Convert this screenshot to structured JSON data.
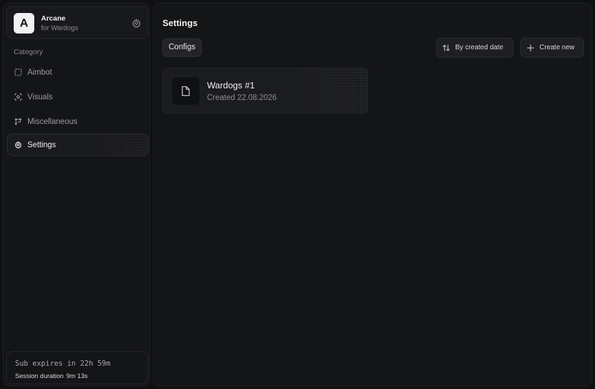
{
  "brand": {
    "logo_letter": "A",
    "name": "Arcane",
    "subtitle": "for Wardogs",
    "settings_icon": "gear-icon"
  },
  "sidebar": {
    "category_label": "Category",
    "items": [
      {
        "label": "Aimbot",
        "icon": "crosshair-square-icon",
        "active": false
      },
      {
        "label": "Visuals",
        "icon": "eye-scan-icon",
        "active": false
      },
      {
        "label": "Miscellaneous",
        "icon": "nodes-icon",
        "active": false
      },
      {
        "label": "Settings",
        "icon": "gear-icon",
        "active": true
      }
    ]
  },
  "footer": {
    "sub_expires": "Sub expires in 22h 59m",
    "session_label": "Session duration",
    "session_value": "9m 13s"
  },
  "main": {
    "title": "Settings",
    "tab_label": "Configs",
    "sort_label": "By created date",
    "create_label": "Create new",
    "configs": [
      {
        "name": "Wardogs #1",
        "created": "Created 22.08.2026",
        "icon": "file-icon"
      }
    ]
  },
  "colors": {
    "background": "#0f1012",
    "panel": "#141517",
    "card": "#1b1c1f",
    "text_primary": "#f0f0f0",
    "text_muted": "#8b8c90"
  }
}
